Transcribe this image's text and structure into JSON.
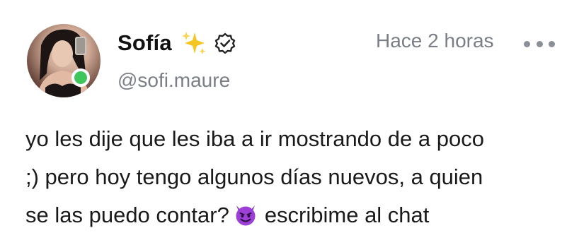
{
  "post": {
    "display_name": "Sofía",
    "username": "@sofi.maure",
    "timestamp": "Hace 2 horas",
    "body_lines": [
      "yo les dije que les iba a ir mostrando de a poco",
      ";) pero hoy tengo algunos días nuevos, a quien",
      "se las puedo contar?",
      "escribime al chat"
    ],
    "icons": {
      "name_emoji": "sparkles-icon",
      "verified": "verified-badge-icon",
      "status": "online-status-dot",
      "more": "more-options-icon",
      "inline_emoji": "smiling-devil-emoji"
    },
    "colors": {
      "online": "#3ec55b",
      "muted_text": "#7a7f87",
      "sparkles": "#f5c623",
      "devil": "#9b3fd6"
    }
  }
}
